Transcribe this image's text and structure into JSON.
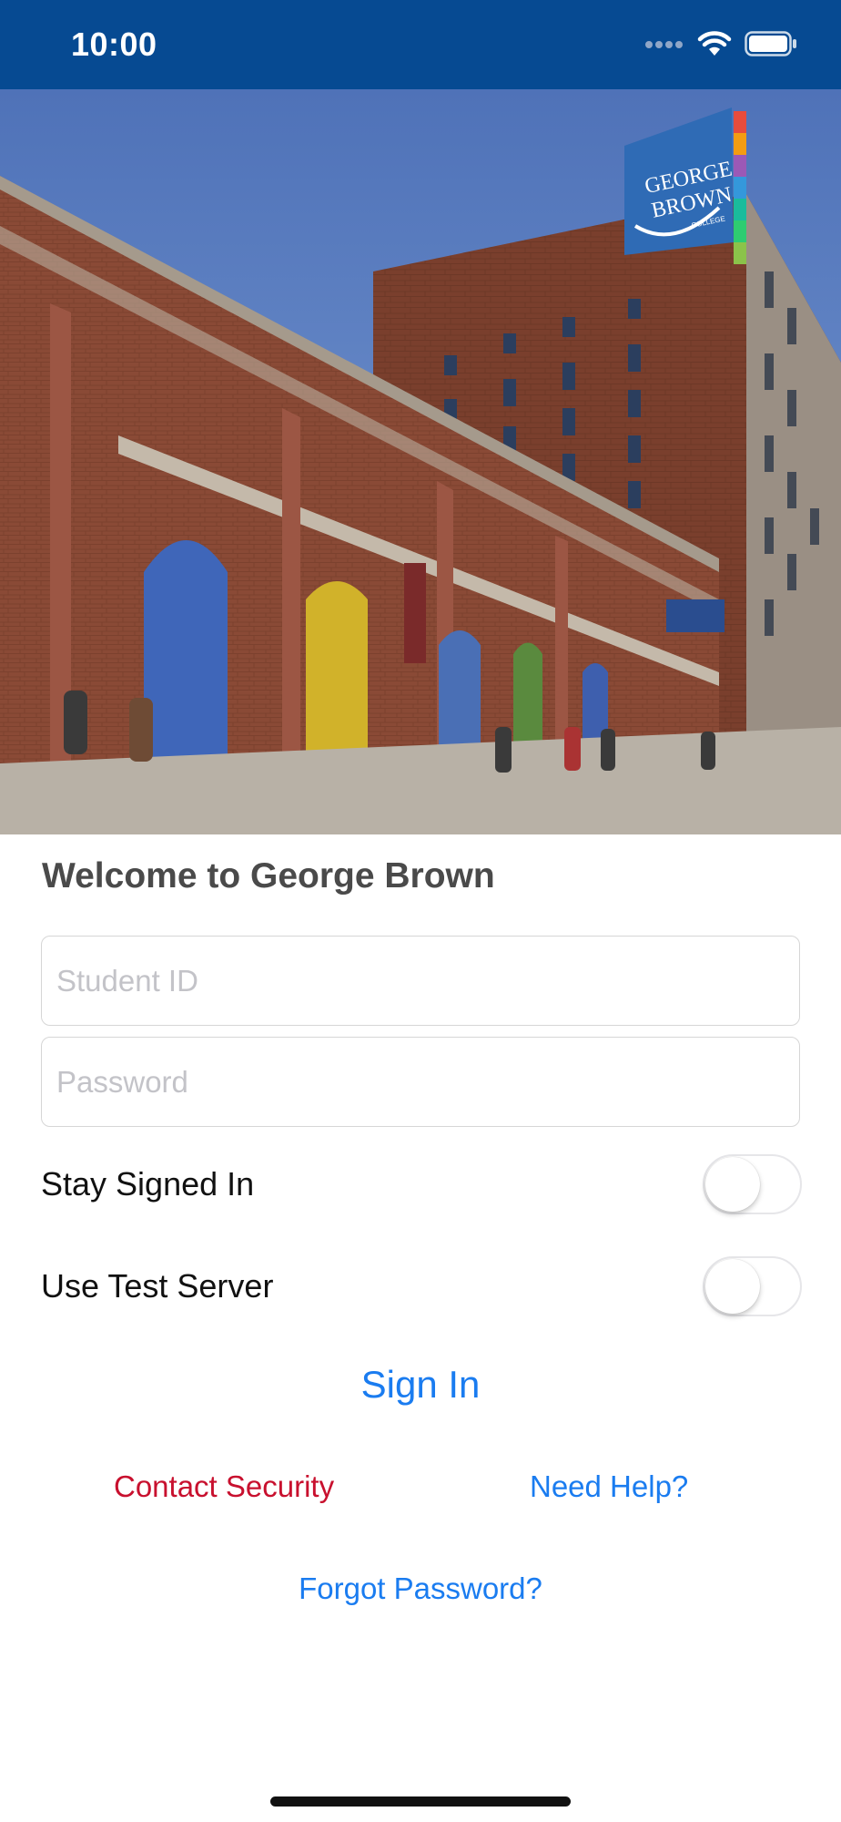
{
  "status_bar": {
    "time": "10:00",
    "icons": [
      "signal-dots-icon",
      "wifi-icon",
      "battery-icon"
    ],
    "background_color": "#064a92"
  },
  "hero": {
    "logo_lines": [
      "GEORGE",
      "BROWN",
      "COLLEGE"
    ]
  },
  "welcome": "Welcome to George Brown",
  "form": {
    "student_id": {
      "value": "",
      "placeholder": "Student ID"
    },
    "password": {
      "value": "",
      "placeholder": "Password"
    },
    "stay_signed_in": {
      "label": "Stay Signed In",
      "on": false
    },
    "use_test_server": {
      "label": "Use Test Server",
      "on": false
    }
  },
  "actions": {
    "sign_in": "Sign In",
    "contact_security": "Contact Security",
    "need_help": "Need Help?",
    "forgot_password": "Forgot Password?"
  },
  "colors": {
    "link": "#1a7cf0",
    "security": "#c8102e",
    "brand_blue": "#064a92"
  }
}
